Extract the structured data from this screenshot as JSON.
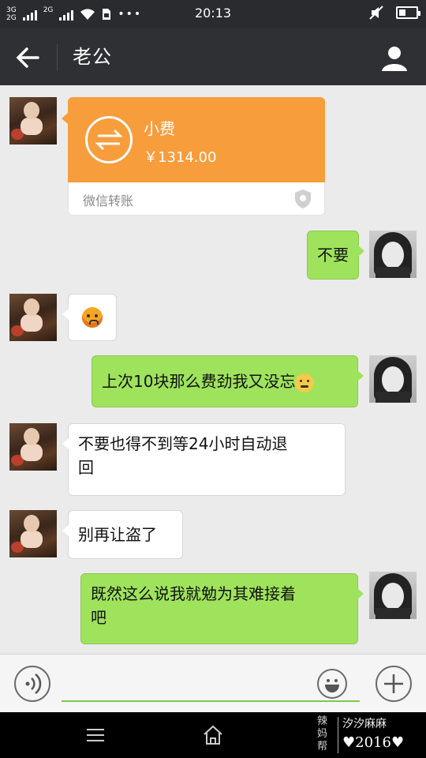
{
  "status_bar": {
    "net1": "3G",
    "net2": "2G",
    "net3": "2G",
    "time": "20:13"
  },
  "header": {
    "title": "老公"
  },
  "messages": {
    "transfer": {
      "title": "小费",
      "amount": "￥1314.00",
      "label": "微信转账"
    },
    "m1": "不要",
    "m3": "上次10块那么费劲我又没忘",
    "m4_line1": "不要也得不到等24小时自动退",
    "m4_line2": "回",
    "m5": "别再让盗了",
    "m6_line1": "既然这么说我就勉为其难接着",
    "m6_line2": "吧"
  },
  "input": {
    "value": "",
    "placeholder": ""
  },
  "watermark": {
    "brand": "辣妈帮",
    "name": "汐汐麻麻",
    "year": "♥2016♥"
  },
  "colors": {
    "header_bg": "#2f3033",
    "chat_bg": "#ebebeb",
    "outgoing_bubble": "#9fe35c",
    "incoming_bubble": "#ffffff",
    "transfer_card": "#f89d3c",
    "input_underline": "#7cc853"
  },
  "icons": {
    "back": "arrow-left-icon",
    "profile": "person-icon",
    "transfer": "exchange-icon",
    "shield": "shield-icon",
    "voice": "voice-icon",
    "emoji": "smiley-icon",
    "plus": "plus-icon",
    "menu": "menu-icon",
    "home": "home-icon"
  }
}
